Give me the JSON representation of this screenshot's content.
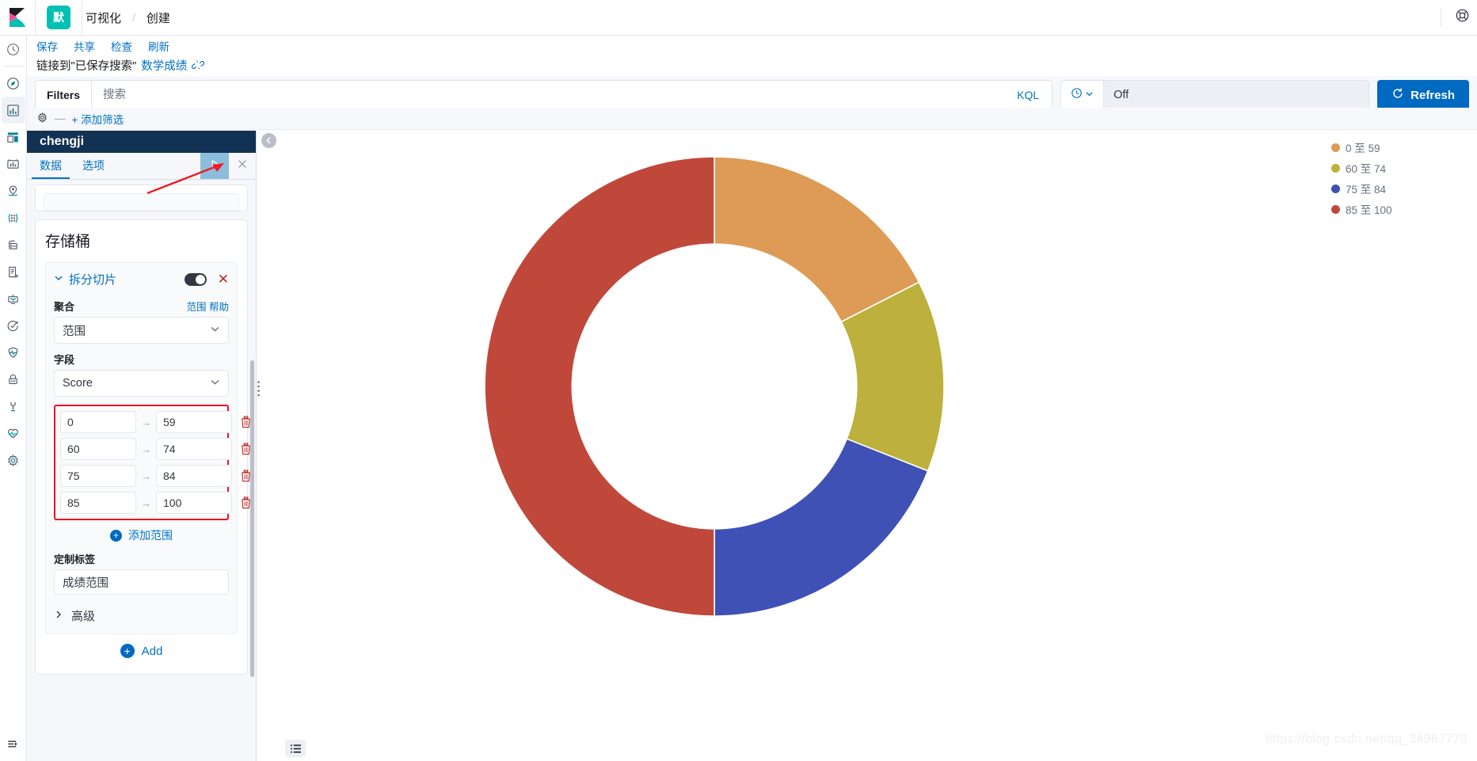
{
  "topnav": {
    "logo_icon": "kibana-logo-icon",
    "space_badge": "默",
    "breadcrumbs": [
      {
        "label": "可视化",
        "current": false
      },
      {
        "label": "创建",
        "current": true
      }
    ],
    "separator": "/",
    "help_icon": "help-circle-icon"
  },
  "rail": {
    "items": [
      {
        "icon": "recently-viewed-clock-icon",
        "active": false
      },
      {
        "icon": "discover-compass-icon",
        "active": false
      },
      {
        "icon": "visualize-bar-chart-icon",
        "active": true
      },
      {
        "icon": "dashboard-grid-icon",
        "active": false
      },
      {
        "icon": "canvas-frame-icon",
        "active": false
      },
      {
        "icon": "maps-location-icon",
        "active": false
      },
      {
        "icon": "machine-learning-nodes-icon",
        "active": false
      },
      {
        "icon": "infrastructure-server-icon",
        "active": false
      },
      {
        "icon": "logs-document-icon",
        "active": false
      },
      {
        "icon": "apm-monitor-icon",
        "active": false
      },
      {
        "icon": "uptime-check-icon",
        "active": false
      },
      {
        "icon": "siem-shield-icon",
        "active": false
      },
      {
        "icon": "security-lock-icon",
        "active": false
      },
      {
        "icon": "dev-tools-wrench-icon",
        "active": false
      },
      {
        "icon": "monitoring-heartbeat-icon",
        "active": false
      },
      {
        "icon": "management-gear-icon",
        "active": false
      }
    ],
    "collapse_icon": "collapse-nav-icon"
  },
  "actionbar": {
    "items": [
      "保存",
      "共享",
      "检查",
      "刷新"
    ]
  },
  "linked_search": {
    "prefix": "链接到\"已保存搜索\"",
    "name": "数学成绩",
    "unlink_icon": "unlink-icon"
  },
  "querybar": {
    "filters_label": "Filters",
    "search_placeholder": "搜索",
    "search_value": "",
    "kql_label": "KQL",
    "date_icon": "calendar-clock-icon",
    "date_caret_icon": "chevron-down-icon",
    "date_value": "Off",
    "refresh_label": "Refresh",
    "refresh_icon": "refresh-icon"
  },
  "filterbar": {
    "gear_icon": "filter-options-gear-icon",
    "dash": "—",
    "add_filter_label": "+ 添加筛选"
  },
  "editor": {
    "title": "chengji",
    "tabs": [
      {
        "label": "数据",
        "active": true
      },
      {
        "label": "选项",
        "active": false
      }
    ],
    "apply_icon": "apply-play-icon",
    "close_icon": "close-x-icon",
    "collapse_icon": "collapse-left-chevron-icon",
    "drag_handle_icon": "vertical-drag-handle-icon",
    "bucket_heading": "存储桶",
    "split_slices": {
      "caret_icon": "chevron-down-icon",
      "label": "拆分切片",
      "toggle_icon": "enable-toggle-switch",
      "toggle_on": true,
      "remove_icon": "remove-x-icon",
      "agg_label": "聚合",
      "agg_help_left": "范围",
      "agg_help_right": "帮助",
      "agg_value": "范围",
      "field_label": "字段",
      "field_value": "Score",
      "ranges": [
        {
          "from": "0",
          "to": "59",
          "delete_icon": "trash-icon"
        },
        {
          "from": "60",
          "to": "74",
          "delete_icon": "trash-icon"
        },
        {
          "from": "75",
          "to": "84",
          "delete_icon": "trash-icon"
        },
        {
          "from": "85",
          "to": "100",
          "delete_icon": "trash-icon"
        }
      ],
      "range_arrow": "→",
      "add_range_label": "添加范围",
      "custom_label_label": "定制标签",
      "custom_label_value": "成绩范围",
      "advanced_label": "高级",
      "advanced_caret_icon": "chevron-right-icon"
    },
    "add_button_label": "Add",
    "highlight_color": "#e81123"
  },
  "chart": {
    "legend_toggle_icon": "legend-list-icon",
    "watermark": "https://blog.csdn.net/qq_34967770"
  },
  "chart_data": {
    "type": "pie",
    "variant": "donut",
    "title": "",
    "labels": [
      "0 至 59",
      "60 至 74",
      "75 至 84",
      "85 至 100"
    ],
    "values": [
      17.5,
      13.5,
      19.0,
      50.0
    ],
    "unit": "percent",
    "colors": [
      "#dd9b55",
      "#bdb03c",
      "#3f51b5",
      "#c0483a"
    ],
    "legend": {
      "position": "right-top",
      "entries": [
        {
          "label": "0 至 59",
          "color": "#dd9b55"
        },
        {
          "label": "60 至 74",
          "color": "#bdb03c"
        },
        {
          "label": "75 至 84",
          "color": "#3f51b5"
        },
        {
          "label": "85 至 100",
          "color": "#c0483a"
        }
      ]
    },
    "start_angle_deg": 0,
    "inner_radius_ratio": 0.62,
    "grid": false
  }
}
